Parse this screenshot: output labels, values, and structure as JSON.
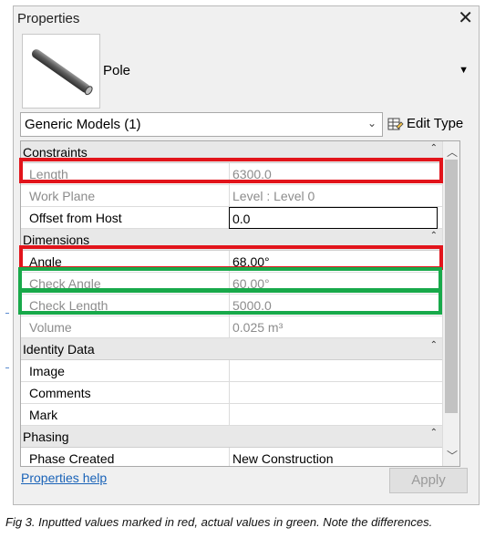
{
  "window": {
    "title": "Properties",
    "close_icon": "close-icon"
  },
  "type_selector": {
    "family_name": "Pole",
    "dropdown_icon": "triangle-down-icon"
  },
  "instance_filter": {
    "selected": "Generic Models (1)",
    "chevron_icon": "chevron-down-icon"
  },
  "edit_type": {
    "label": "Edit Type",
    "icon": "edit-type-icon"
  },
  "groups": [
    {
      "label": "Constraints",
      "params": [
        {
          "name": "Length",
          "value": "6300.0",
          "readonly": true
        },
        {
          "name": "Work Plane",
          "value": "Level : Level 0",
          "readonly": true
        },
        {
          "name": "Offset from Host",
          "value": "0.0",
          "readonly": false,
          "editing": true
        }
      ]
    },
    {
      "label": "Dimensions",
      "params": [
        {
          "name": "Angle",
          "value": "68.00°",
          "readonly": false
        },
        {
          "name": "Check Angle",
          "value": "60.00°",
          "readonly": true
        },
        {
          "name": "Check Length",
          "value": "5000.0",
          "readonly": true
        },
        {
          "name": "Volume",
          "value": "0.025 m³",
          "readonly": true
        }
      ]
    },
    {
      "label": "Identity Data",
      "params": [
        {
          "name": "Image",
          "value": "",
          "readonly": false
        },
        {
          "name": "Comments",
          "value": "",
          "readonly": false
        },
        {
          "name": "Mark",
          "value": "",
          "readonly": false
        }
      ]
    },
    {
      "label": "Phasing",
      "params": [
        {
          "name": "Phase Created",
          "value": "New Construction",
          "readonly": false
        }
      ]
    }
  ],
  "footer": {
    "help_link": "Properties help",
    "apply_label": "Apply"
  },
  "annotations": {
    "red": "#e2141b",
    "green": "#18a94a"
  },
  "caption": "Fig 3. Inputted values marked in red, actual values in green. Note the differences."
}
